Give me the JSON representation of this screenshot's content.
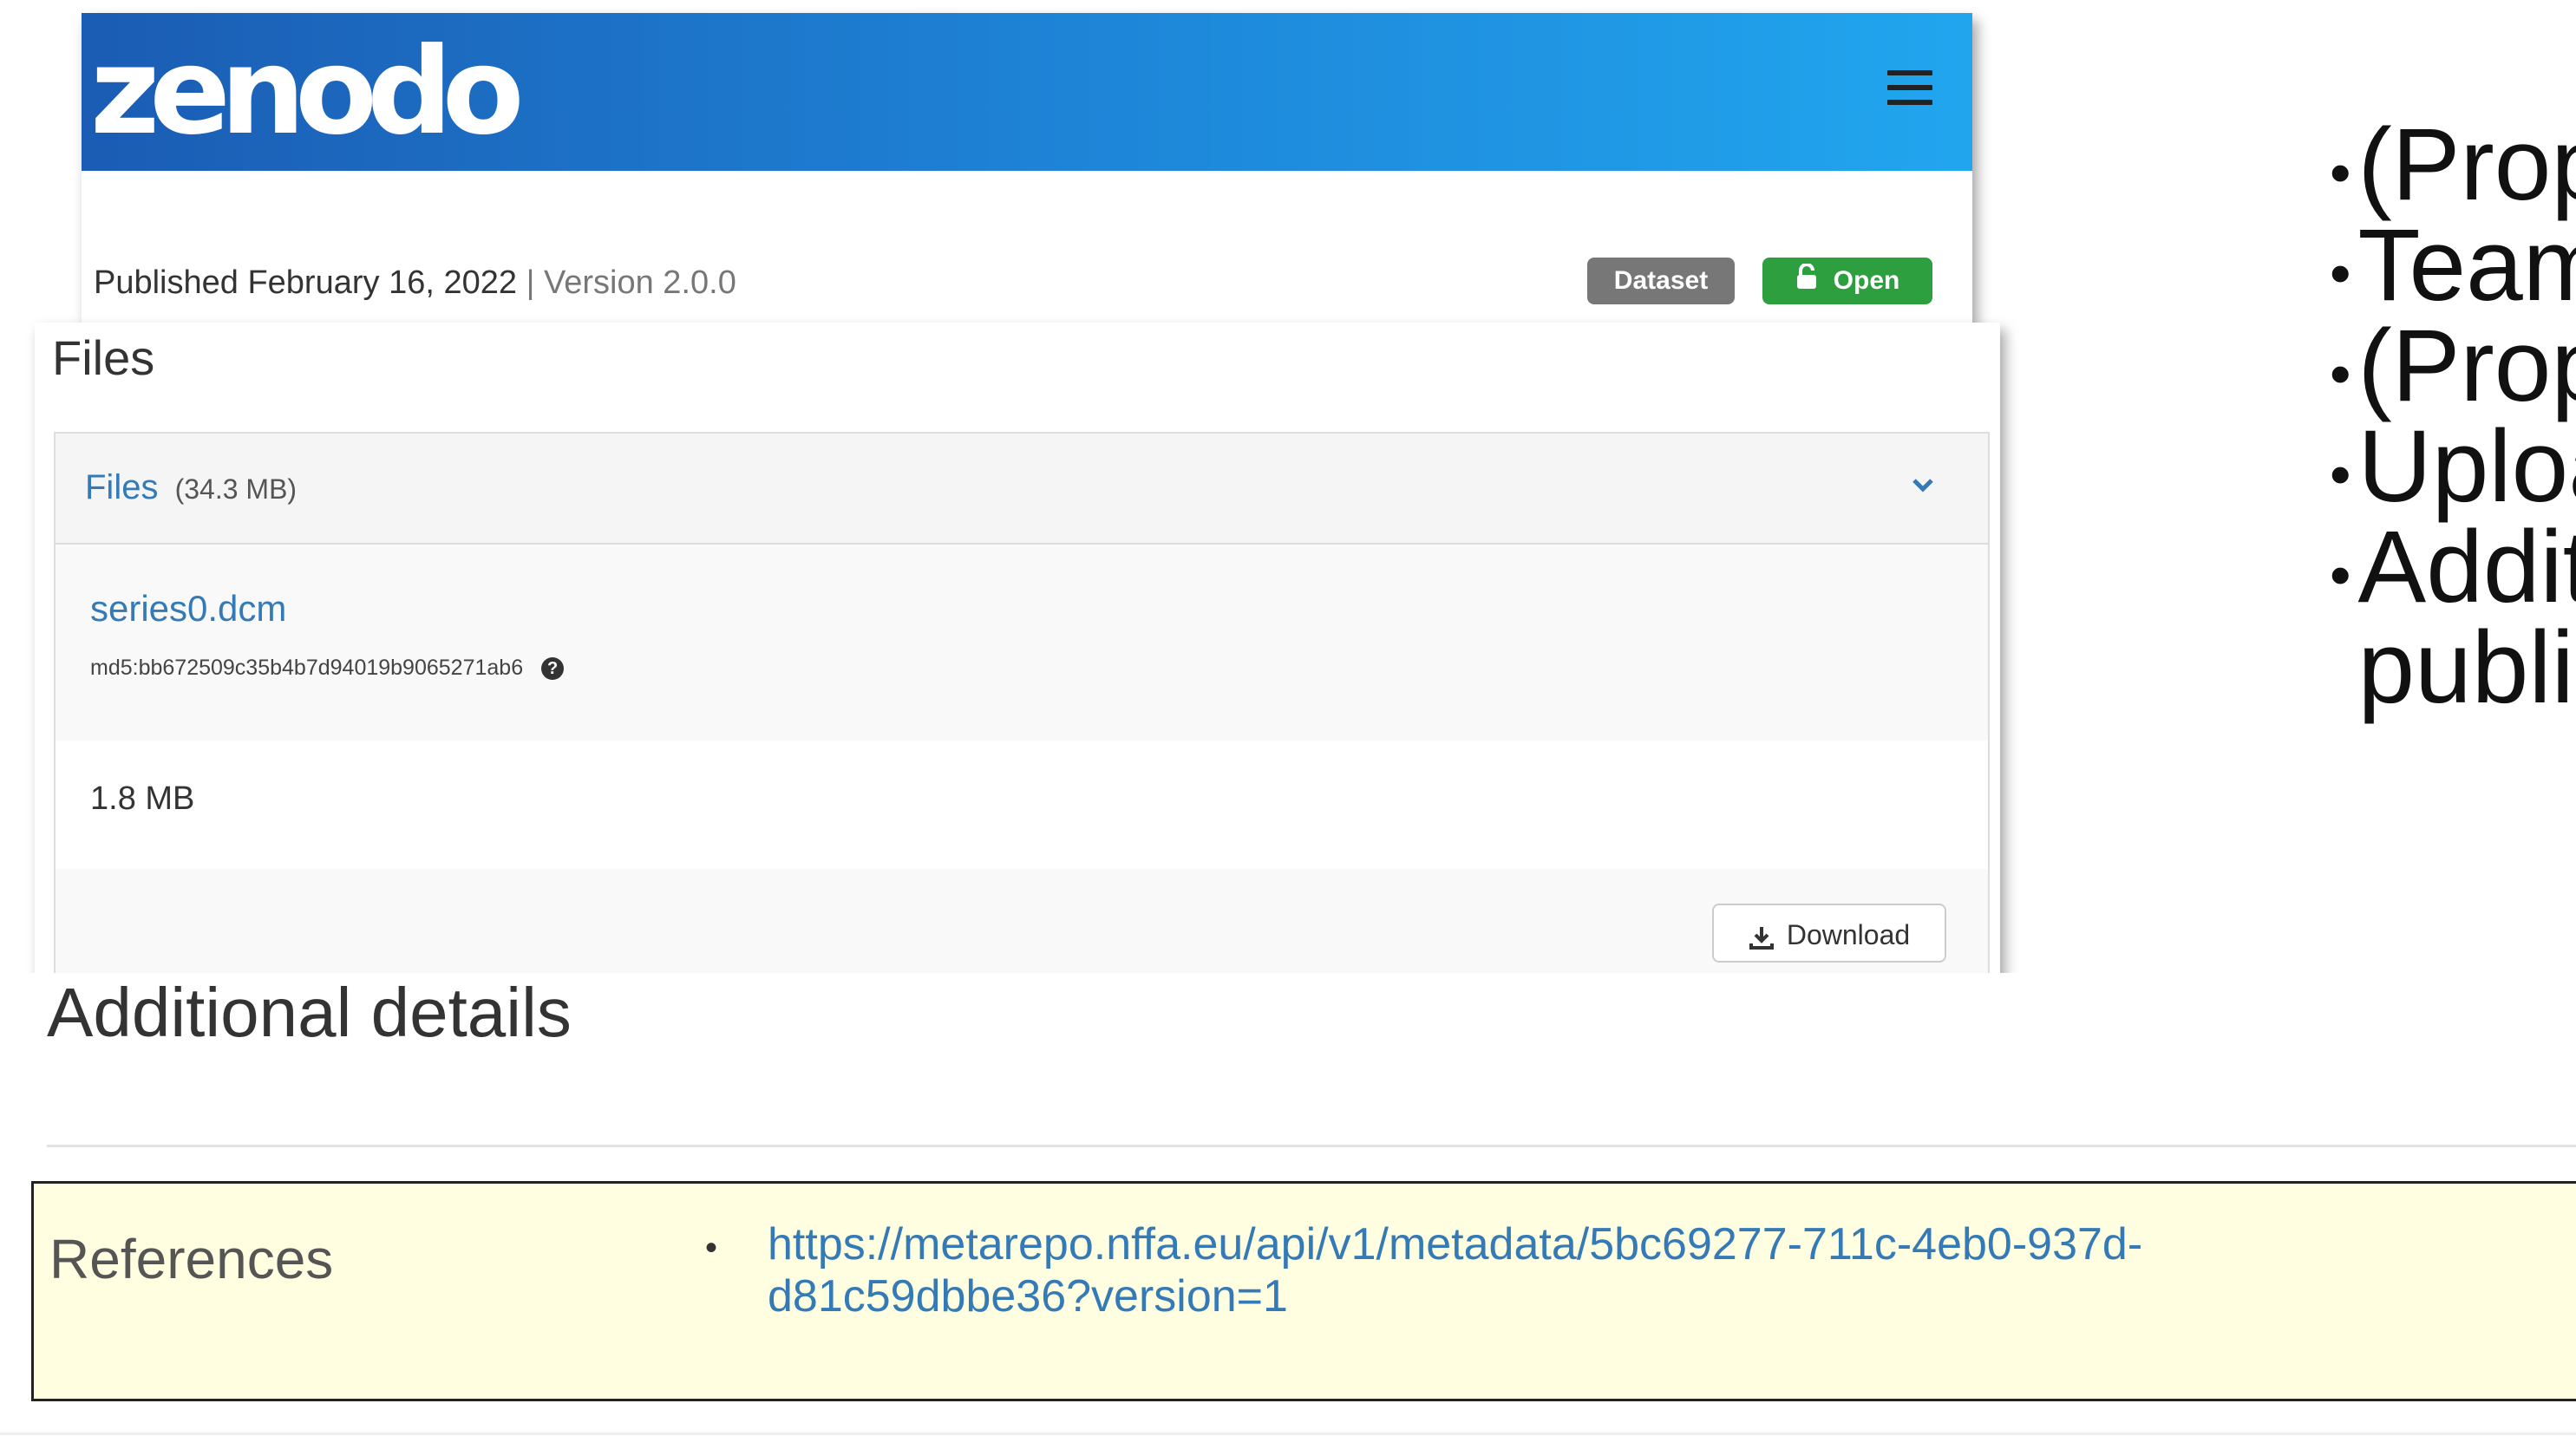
{
  "header": {
    "logo_text": "zenodo",
    "menu_icon": "hamburger-menu-icon",
    "brand_gradient": [
      "#1b5cb4",
      "#21a6ee"
    ]
  },
  "record": {
    "published": "Published February 16, 2022",
    "separator": "|",
    "version": "Version 2.0.0",
    "badge_type": "Dataset",
    "badge_access": "Open",
    "badge_access_icon": "lock-open-icon"
  },
  "files": {
    "title": "Files",
    "panel_label": "Files",
    "panel_size": "(34.3 MB)",
    "toggle_icon": "chevron-down-icon",
    "file_name": "series0.dcm",
    "md5": "md5:bb672509c35b4b7d94019b9065271ab6",
    "md5_help_icon": "question-circle-icon",
    "q_glyph": "?",
    "size": "1.8 MB",
    "download_label": "Download",
    "download_icon": "download-icon"
  },
  "details": {
    "title": "Additional details",
    "references_label": "References",
    "bullet": "•",
    "reference_url": "https://metarepo.nffa.eu/api/v1/metadata/5bc69277-711c-4eb0-937d-d81c59dbbe36?version=1"
  },
  "side_bullets": [
    "(Prop",
    "Team",
    "(Prop",
    "Uploa",
    "Addit",
    "publi"
  ],
  "colors": {
    "link": "#337ab7",
    "open_badge": "#2e9f3f",
    "dataset_badge": "#777777",
    "reference_bg": "#fffee0"
  }
}
